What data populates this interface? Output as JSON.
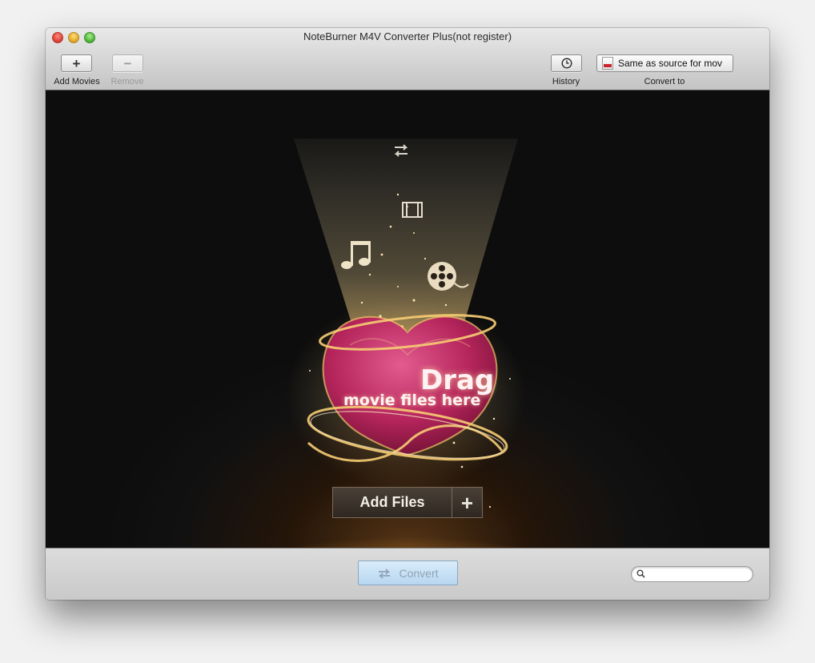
{
  "window": {
    "title": "NoteBurner M4V Converter Plus(not register)"
  },
  "toolbar": {
    "add_movies_label": "Add Movies",
    "remove_label": "Remove",
    "history_label": "History",
    "convert_to_label": "Convert to",
    "convert_to_value": "Same as source for mov"
  },
  "dropzone": {
    "drag_title": "Drag",
    "drag_subtitle": "movie files here",
    "add_files_label": "Add Files",
    "add_files_plus": "+"
  },
  "footer": {
    "convert_label": "Convert",
    "search_value": ""
  },
  "icons": {
    "close": "close-traffic-light",
    "minimize": "minimize-traffic-light",
    "maximize": "maximize-traffic-light",
    "add": "plus-icon",
    "remove": "minus-icon",
    "history": "clock-icon",
    "format": "file-format-icon",
    "convert": "convert-arrows-icon",
    "search": "magnifier-icon"
  },
  "colors": {
    "accent_heart": "#b3245a",
    "glow": "#f6c96a",
    "convert_button": "#c6e0f5"
  }
}
